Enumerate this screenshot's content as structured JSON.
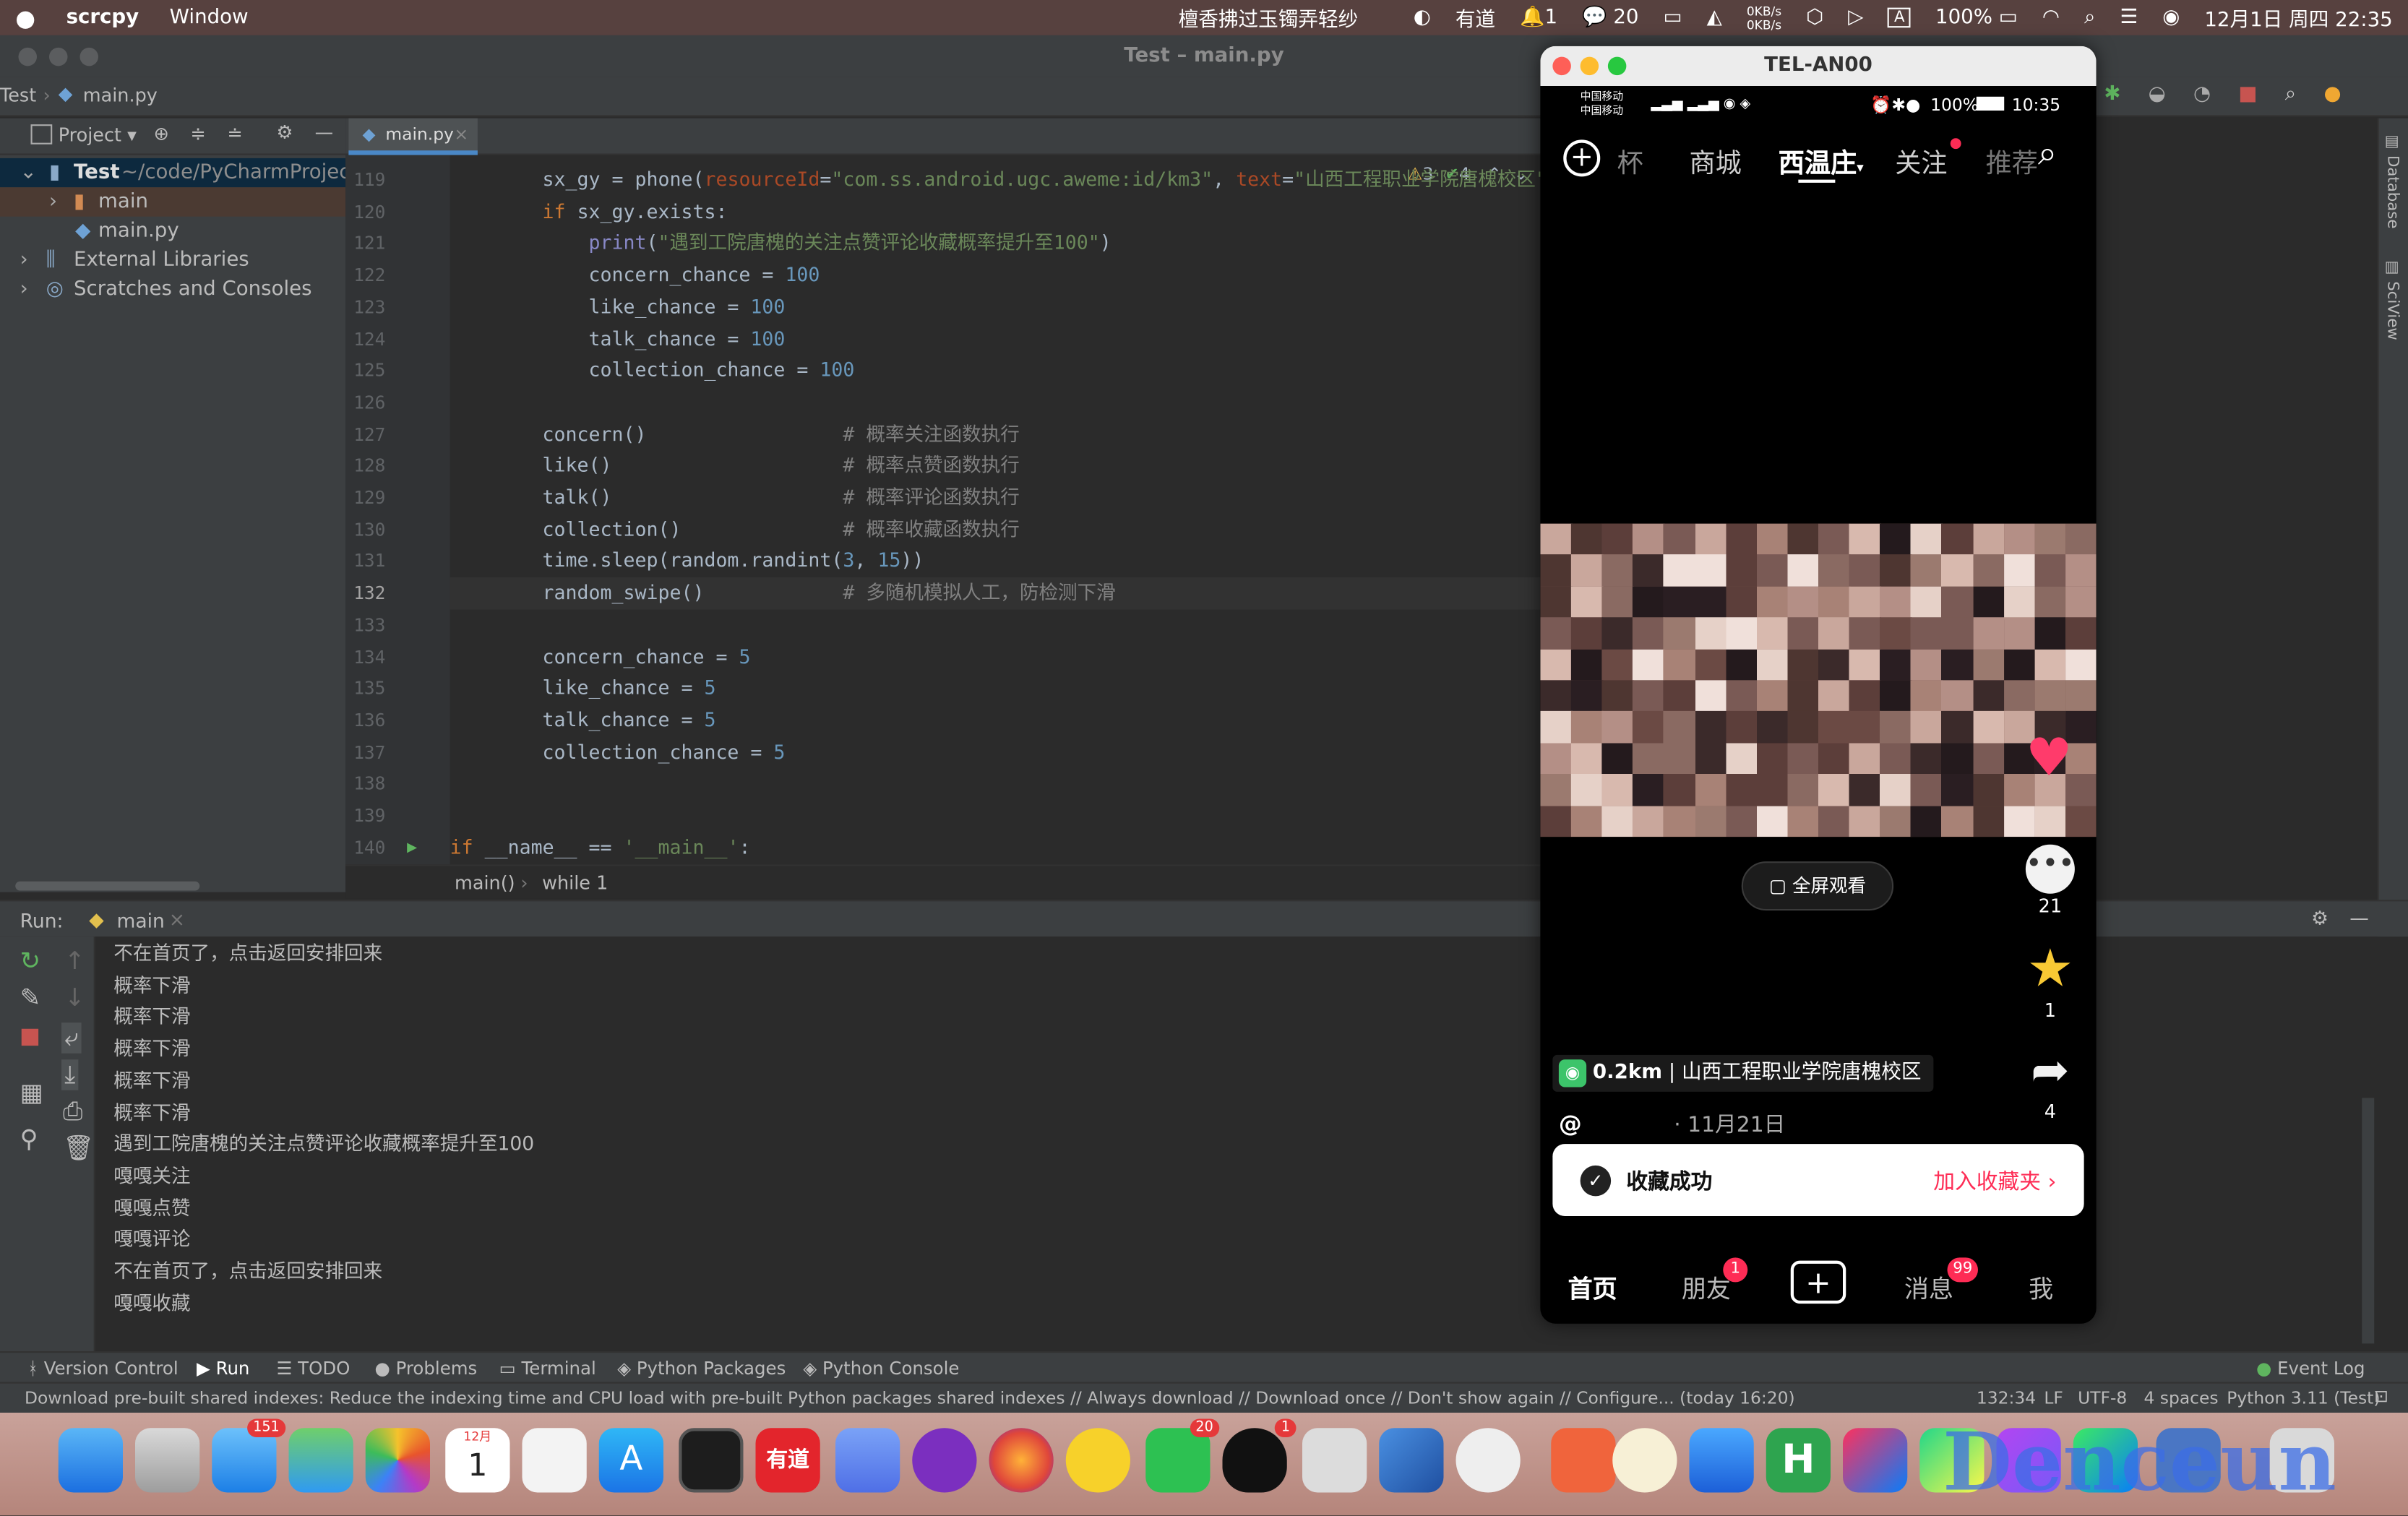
{
  "menubar": {
    "app": "scrcpy",
    "menu_window": "Window",
    "center_text": "檀香拂过玉镯弄轻纱",
    "youdao": "有道",
    "bell_count": "1",
    "wechat_count": "20",
    "net_up": "0KB/s",
    "net_down": "0KB/s",
    "battery": "100%",
    "datetime": "12月1日 周四 22:35"
  },
  "ide": {
    "window_title": "Test – main.py",
    "nav": {
      "project": "Test",
      "file": "main.py"
    },
    "project_label": "Project",
    "tree": [
      {
        "label": "Test",
        "path": "~/code/PyCharmProject/Te"
      },
      {
        "label": "main"
      },
      {
        "label": "main.py"
      },
      {
        "label": "External Libraries"
      },
      {
        "label": "Scratches and Consoles"
      }
    ],
    "tab": "main.py",
    "inspections": {
      "warnings": "3",
      "ok": "4"
    },
    "code": [
      {
        "n": "119",
        "parts": [
          [
            "",
            "        sx_gy = phone("
          ],
          [
            "prm",
            "resourceId"
          ],
          [
            "",
            "="
          ],
          [
            "str",
            "\"com.ss.android.ugc.aweme:id/km3\""
          ],
          [
            "",
            ", "
          ],
          [
            "prm",
            "text"
          ],
          [
            "",
            "="
          ],
          [
            "str",
            "\"山西工程职业学院唐槐校区\""
          ],
          [
            "",
            ")"
          ]
        ]
      },
      {
        "n": "120",
        "parts": [
          [
            "kw",
            "        if "
          ],
          [
            "",
            "sx_gy.exists:"
          ]
        ]
      },
      {
        "n": "121",
        "parts": [
          [
            "bi",
            "            print"
          ],
          [
            "",
            "("
          ],
          [
            "str",
            "\"遇到工院唐槐的关注点赞评论收藏概率提升至100\""
          ],
          [
            "",
            ")"
          ]
        ]
      },
      {
        "n": "122",
        "parts": [
          [
            "",
            "            concern_chance = "
          ],
          [
            "num",
            "100"
          ]
        ]
      },
      {
        "n": "123",
        "parts": [
          [
            "",
            "            like_chance = "
          ],
          [
            "num",
            "100"
          ]
        ]
      },
      {
        "n": "124",
        "parts": [
          [
            "",
            "            talk_chance = "
          ],
          [
            "num",
            "100"
          ]
        ]
      },
      {
        "n": "125",
        "parts": [
          [
            "",
            "            collection_chance = "
          ],
          [
            "num",
            "100"
          ]
        ]
      },
      {
        "n": "126",
        "parts": [
          [
            "",
            ""
          ]
        ]
      },
      {
        "n": "127",
        "parts": [
          [
            "",
            "        concern()                 "
          ],
          [
            "cm",
            "# 概率关注函数执行"
          ]
        ]
      },
      {
        "n": "128",
        "parts": [
          [
            "",
            "        like()                    "
          ],
          [
            "cm",
            "# 概率点赞函数执行"
          ]
        ]
      },
      {
        "n": "129",
        "parts": [
          [
            "",
            "        talk()                    "
          ],
          [
            "cm",
            "# 概率评论函数执行"
          ]
        ]
      },
      {
        "n": "130",
        "parts": [
          [
            "",
            "        collection()              "
          ],
          [
            "cm",
            "# 概率收藏函数执行"
          ]
        ]
      },
      {
        "n": "131",
        "parts": [
          [
            "",
            "        time.sleep(random.randint("
          ],
          [
            "num",
            "3"
          ],
          [
            "",
            ", "
          ],
          [
            "num",
            "15"
          ],
          [
            "",
            "))"
          ]
        ]
      },
      {
        "n": "132",
        "parts": [
          [
            "",
            "        random_swipe()            "
          ],
          [
            "cm",
            "# 多随机模拟人工，防检测下滑"
          ]
        ],
        "current": true
      },
      {
        "n": "133",
        "parts": [
          [
            "",
            ""
          ]
        ]
      },
      {
        "n": "134",
        "parts": [
          [
            "",
            "        concern_chance = "
          ],
          [
            "num",
            "5"
          ]
        ]
      },
      {
        "n": "135",
        "parts": [
          [
            "",
            "        like_chance = "
          ],
          [
            "num",
            "5"
          ]
        ]
      },
      {
        "n": "136",
        "parts": [
          [
            "",
            "        talk_chance = "
          ],
          [
            "num",
            "5"
          ]
        ]
      },
      {
        "n": "137",
        "parts": [
          [
            "",
            "        collection_chance = "
          ],
          [
            "num",
            "5"
          ]
        ]
      },
      {
        "n": "138",
        "parts": [
          [
            "",
            ""
          ]
        ]
      },
      {
        "n": "139",
        "parts": [
          [
            "",
            ""
          ]
        ]
      },
      {
        "n": "140",
        "parts": [
          [
            "kw",
            "if "
          ],
          [
            "",
            "__name__ == "
          ],
          [
            "str",
            "'__main__'"
          ],
          [
            "",
            ":"
          ]
        ]
      }
    ],
    "breadcrumb": {
      "fn": "main()",
      "loop": "while 1"
    },
    "run": {
      "label": "Run:",
      "tab": "main",
      "lines": [
        "不在首页了，点击返回安排回来",
        "概率下滑",
        "概率下滑",
        "概率下滑",
        "概率下滑",
        "概率下滑",
        "遇到工院唐槐的关注点赞评论收藏概率提升至100",
        "嘎嘎关注",
        "嘎嘎点赞",
        "嘎嘎评论",
        "不在首页了，点击返回安排回来",
        "嘎嘎收藏"
      ]
    },
    "toolwindows": [
      "Version Control",
      "Run",
      "TODO",
      "Problems",
      "Terminal",
      "Python Packages",
      "Python Console"
    ],
    "event_log": "Event Log",
    "status": {
      "message": "Download pre-built shared indexes: Reduce the indexing time and CPU load with pre-built Python packages shared indexes // Always download // Download once // Don't show again // Configure... (today 16:20)",
      "position": "132:34",
      "lf": "LF",
      "encoding": "UTF-8",
      "indent": "4 spaces",
      "interpreter": "Python 3.11 (Test)"
    },
    "sidebar_right": [
      "Database",
      "SciView"
    ]
  },
  "phone": {
    "title": "TEL-AN00",
    "carrier1": "中国移动",
    "carrier2": "中国移动",
    "battery": "100%",
    "time": "10:35",
    "top_tabs": [
      "杯",
      "商城",
      "西温庄",
      "关注",
      "推荐"
    ],
    "fullscreen": "全屏观看",
    "comments": "21",
    "favorites": "1",
    "shares": "4",
    "distance": "0.2km",
    "location": "山西工程职业学院唐槐校区",
    "author_prefix": "@",
    "date": "· 11月21日",
    "toast": {
      "text": "收藏成功",
      "action": "加入收藏夹"
    },
    "bottom_tabs": [
      "首页",
      "朋友",
      "消息",
      "我"
    ],
    "friend_badge": "1",
    "message_badge": "99"
  },
  "dock": {
    "mail_badge": "151",
    "calendar_month": "12月",
    "calendar_day": "1",
    "youdao": "有道",
    "wechat_badge": "20",
    "qq_badge": "1",
    "watermark": "Denceun"
  }
}
